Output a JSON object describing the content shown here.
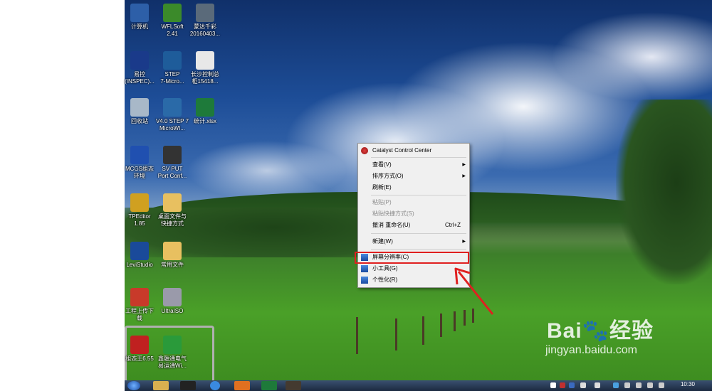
{
  "desktop_icons": [
    {
      "label": "计算机",
      "icon": "computer-icon",
      "color": "#2d5fa8"
    },
    {
      "label": "WFLSoft\n2.41",
      "icon": "wflsoft-icon",
      "color": "#3b8a2a"
    },
    {
      "label": "蒙达千彩\n20160403...",
      "icon": "document-icon",
      "color": "#5a6a7a"
    },
    {
      "label": "易控\n(INSPEC)...",
      "icon": "inspec-icon",
      "color": "#1a3a8a"
    },
    {
      "label": "STEP\n7-Micro...",
      "icon": "step7-icon",
      "color": "#1e5c9a"
    },
    {
      "label": "长沙控制总\n柜15418...",
      "icon": "file-icon",
      "color": "#e8e8e8"
    },
    {
      "label": "回收站",
      "icon": "recycle-bin-icon",
      "color": "#a8b8c8"
    },
    {
      "label": "V4.0 STEP 7\nMicroWI...",
      "icon": "step7-microwin-icon",
      "color": "#2a6aa8"
    },
    {
      "label": "统计.xlsx",
      "icon": "excel-icon",
      "color": "#1e7a3a"
    },
    {
      "label": "MCGS组态\n环境",
      "icon": "mcgs-icon",
      "color": "#2050b0"
    },
    {
      "label": "SV PUT\nPort Conf...",
      "icon": "svput-icon",
      "color": "#333333"
    },
    {
      "label": "TPEditor\n1.85",
      "icon": "tpeditor-icon",
      "color": "#d0a020"
    },
    {
      "label": "桌面文件与\n快捷方式",
      "icon": "folder-icon",
      "color": "#e8c060"
    },
    {
      "label": "LeviStudio",
      "icon": "levistudio-icon",
      "color": "#1a4a9a"
    },
    {
      "label": "常用文件",
      "icon": "folder-icon",
      "color": "#e8c060"
    },
    {
      "label": "工程上传下\n载",
      "icon": "upload-icon",
      "color": "#c83a2a"
    },
    {
      "label": "UltraISO",
      "icon": "ultraiso-icon",
      "color": "#9a9aaa"
    },
    {
      "label": "组态王6.55",
      "icon": "kingview-icon",
      "color": "#c02020"
    },
    {
      "label": "鑫融通电气\n易运通Wi...",
      "icon": "xinrongtong-icon",
      "color": "#2a9a3a"
    }
  ],
  "context_menu": {
    "items": [
      {
        "label": "Catalyst Control Center",
        "shortcut": "",
        "submenu": false,
        "disabled": false,
        "icon": "catalyst-icon"
      },
      {
        "label": "查看(V)",
        "shortcut": "",
        "submenu": true,
        "disabled": false
      },
      {
        "label": "排序方式(O)",
        "shortcut": "",
        "submenu": true,
        "disabled": false
      },
      {
        "label": "刷新(E)",
        "shortcut": "",
        "submenu": false,
        "disabled": false
      },
      {
        "label": "粘贴(P)",
        "shortcut": "",
        "submenu": false,
        "disabled": true
      },
      {
        "label": "粘贴快捷方式(S)",
        "shortcut": "",
        "submenu": false,
        "disabled": true
      },
      {
        "label": "撤消 重命名(U)",
        "shortcut": "Ctrl+Z",
        "submenu": false,
        "disabled": false
      },
      {
        "label": "新建(W)",
        "shortcut": "",
        "submenu": true,
        "disabled": false
      },
      {
        "label": "屏幕分辨率(C)",
        "shortcut": "",
        "submenu": false,
        "disabled": false,
        "icon": "screen-resolution-icon"
      },
      {
        "label": "小工具(G)",
        "shortcut": "",
        "submenu": false,
        "disabled": false,
        "icon": "gadgets-icon"
      },
      {
        "label": "个性化(R)",
        "shortcut": "",
        "submenu": false,
        "disabled": false,
        "icon": "personalize-icon"
      }
    ],
    "highlighted": "屏幕分辨率(C)"
  },
  "taskbar": {
    "clock": "10:30",
    "apps": [
      "start-orb",
      "explorer",
      "qq",
      "browser",
      "app-orange",
      "excel",
      "app-dark"
    ]
  },
  "watermark": {
    "logo": "Bai🐾经验",
    "url": "jingyan.baidu.com"
  },
  "colors": {
    "highlight_box": "#e02020",
    "arrow": "#e02020",
    "menu_bg": "#f0f0f0"
  }
}
